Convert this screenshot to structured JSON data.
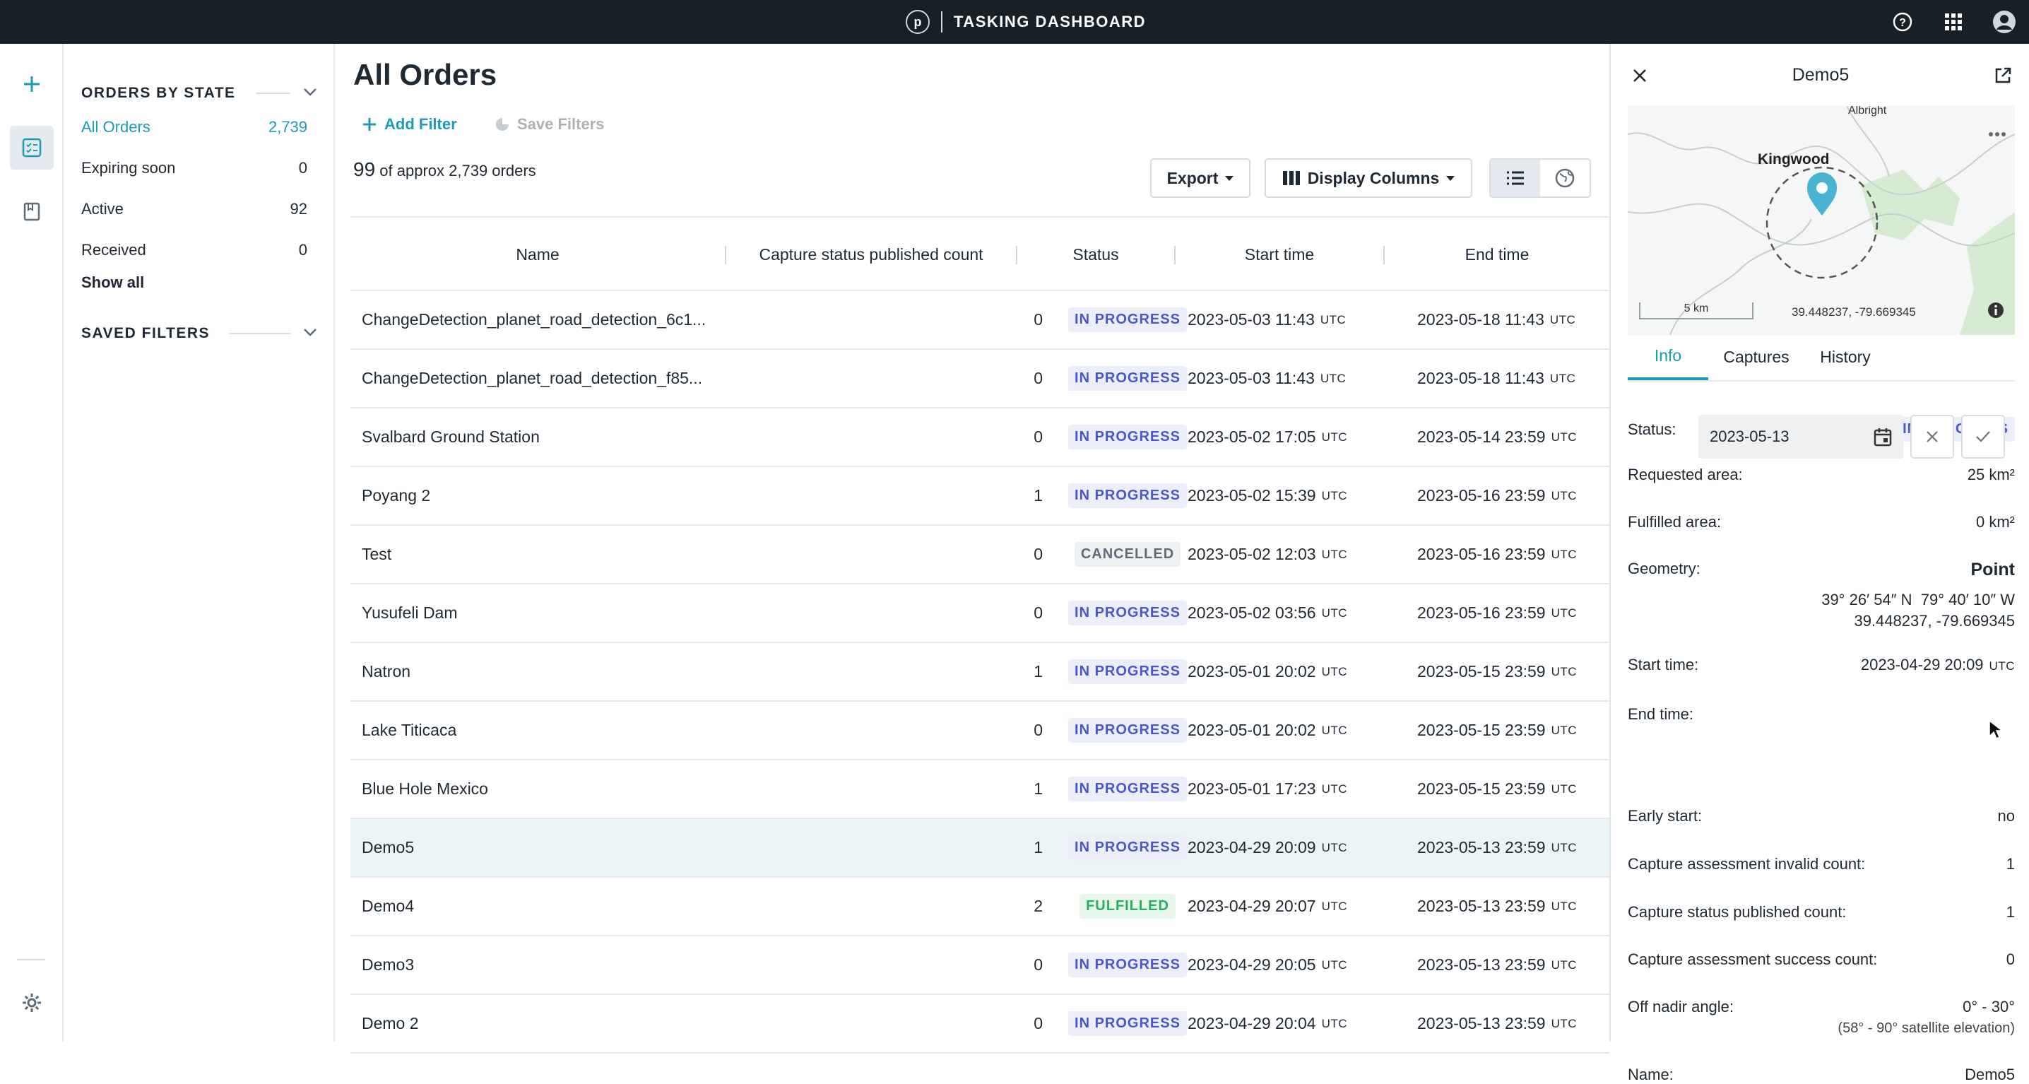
{
  "header": {
    "logo_letter": "p",
    "title": "TASKING DASHBOARD"
  },
  "sidebar": {
    "orders_by_state_label": "ORDERS BY STATE",
    "items": [
      {
        "label": "All Orders",
        "count": "2,739"
      },
      {
        "label": "Expiring soon",
        "count": "0"
      },
      {
        "label": "Active",
        "count": "92"
      },
      {
        "label": "Received",
        "count": "0"
      }
    ],
    "show_all_label": "Show all",
    "saved_filters_label": "SAVED FILTERS"
  },
  "main": {
    "title": "All Orders",
    "add_filter_label": "Add Filter",
    "save_filters_label": "Save Filters",
    "shown_count": "99",
    "count_suffix": "of approx 2,739 orders",
    "export_label": "Export",
    "display_columns_label": "Display Columns",
    "columns": [
      "Name",
      "Capture status published count",
      "Status",
      "Start time",
      "End time"
    ],
    "utc_label": "UTC",
    "rows": [
      {
        "name": "ChangeDetection_planet_road_detection_6c1...",
        "count": "0",
        "status": "IN PROGRESS",
        "start": "2023-05-03 11:43",
        "end": "2023-05-18 11:43"
      },
      {
        "name": "ChangeDetection_planet_road_detection_f85...",
        "count": "0",
        "status": "IN PROGRESS",
        "start": "2023-05-03 11:43",
        "end": "2023-05-18 11:43"
      },
      {
        "name": "Svalbard Ground Station",
        "count": "0",
        "status": "IN PROGRESS",
        "start": "2023-05-02 17:05",
        "end": "2023-05-14 23:59"
      },
      {
        "name": "Poyang 2",
        "count": "1",
        "status": "IN PROGRESS",
        "start": "2023-05-02 15:39",
        "end": "2023-05-16 23:59"
      },
      {
        "name": "Test",
        "count": "0",
        "status": "CANCELLED",
        "start": "2023-05-02 12:03",
        "end": "2023-05-16 23:59"
      },
      {
        "name": "Yusufeli Dam",
        "count": "0",
        "status": "IN PROGRESS",
        "start": "2023-05-02 03:56",
        "end": "2023-05-16 23:59"
      },
      {
        "name": "Natron",
        "count": "1",
        "status": "IN PROGRESS",
        "start": "2023-05-01 20:02",
        "end": "2023-05-15 23:59"
      },
      {
        "name": "Lake Titicaca",
        "count": "0",
        "status": "IN PROGRESS",
        "start": "2023-05-01 20:02",
        "end": "2023-05-15 23:59"
      },
      {
        "name": "Blue Hole Mexico",
        "count": "1",
        "status": "IN PROGRESS",
        "start": "2023-05-01 17:23",
        "end": "2023-05-15 23:59"
      },
      {
        "name": "Demo5",
        "count": "1",
        "status": "IN PROGRESS",
        "start": "2023-04-29 20:09",
        "end": "2023-05-13 23:59",
        "selected": true
      },
      {
        "name": "Demo4",
        "count": "2",
        "status": "FULFILLED",
        "start": "2023-04-29 20:07",
        "end": "2023-05-13 23:59"
      },
      {
        "name": "Demo3",
        "count": "0",
        "status": "IN PROGRESS",
        "start": "2023-04-29 20:05",
        "end": "2023-05-13 23:59"
      },
      {
        "name": "Demo 2",
        "count": "0",
        "status": "IN PROGRESS",
        "start": "2023-04-29 20:04",
        "end": "2023-05-13 23:59"
      }
    ]
  },
  "detail": {
    "title": "Demo5",
    "map": {
      "place_top": "Albright",
      "place_label": "Kingwood",
      "scale_label": "5 km",
      "coords": "39.448237, -79.669345"
    },
    "tabs": [
      "Info",
      "Captures",
      "History"
    ],
    "status_label": "Status:",
    "status_value": "IN PROGRESS",
    "requested_label": "Requested area:",
    "requested_value": "25 km²",
    "fulfilled_label": "Fulfilled area:",
    "fulfilled_value": "0 km²",
    "geometry_label": "Geometry:",
    "geometry_type": "Point",
    "geometry_dms": "39° 26′ 54″ N  79° 40′ 10″ W",
    "geometry_decimal": "39.448237, -79.669345",
    "start_label": "Start time:",
    "start_value": "2023-04-29 20:09",
    "end_label": "End time:",
    "end_input_value": "2023-05-13",
    "early_start_label": "Early start:",
    "early_start_value": "no",
    "invalid_label": "Capture assessment invalid count:",
    "invalid_value": "1",
    "published_label": "Capture status published count:",
    "published_value": "1",
    "success_label": "Capture assessment success count:",
    "success_value": "0",
    "off_nadir_label": "Off nadir angle:",
    "off_nadir_value": "0° - 30°",
    "off_nadir_sub": "(58° - 90° satellite elevation)",
    "name_label": "Name:",
    "name_value": "Demo5"
  },
  "colors": {
    "accent": "#1c9bb7",
    "topbar": "#172027",
    "in_progress": "#4a57c8",
    "fulfilled": "#27ae60",
    "cancelled": "#5f6b77"
  }
}
